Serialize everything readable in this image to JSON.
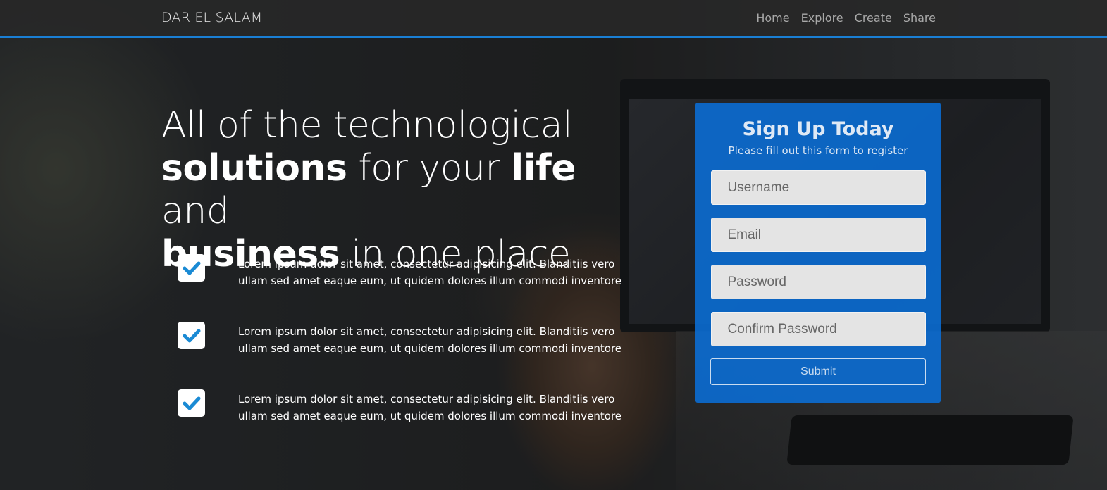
{
  "brand": "DAR EL SALAM",
  "nav": {
    "items": [
      "Home",
      "Explore",
      "Create",
      "Share"
    ]
  },
  "hero": {
    "line1": "All of the technological",
    "line2_bold1": "solutions",
    "line2_rest1": " for your ",
    "line2_bold2": "life",
    "line2_rest2": " and",
    "line3_bold": "business",
    "line3_rest": " in one place"
  },
  "features": [
    {
      "icon": "check-icon",
      "text": "Lorem ipsum dolor sit amet, consectetur adipisicing elit. Blanditiis vero ullam sed amet eaque eum, ut quidem dolores illum commodi inventore"
    },
    {
      "icon": "check-icon",
      "text": "Lorem ipsum dolor sit amet, consectetur adipisicing elit. Blanditiis vero ullam sed amet eaque eum, ut quidem dolores illum commodi inventore"
    },
    {
      "icon": "check-icon",
      "text": "Lorem ipsum dolor sit amet, consectetur adipisicing elit. Blanditiis vero ullam sed amet eaque eum, ut quidem dolores illum commodi inventore"
    }
  ],
  "signup": {
    "title": "Sign Up Today",
    "subtitle": "Please fill out this form to register",
    "username_placeholder": "Username",
    "email_placeholder": "Email",
    "password_placeholder": "Password",
    "confirm_placeholder": "Confirm Password",
    "submit_label": "Submit"
  },
  "colors": {
    "accent": "#1a7fd4",
    "card": "#0a6ed7",
    "check": "#1a8ad4"
  }
}
